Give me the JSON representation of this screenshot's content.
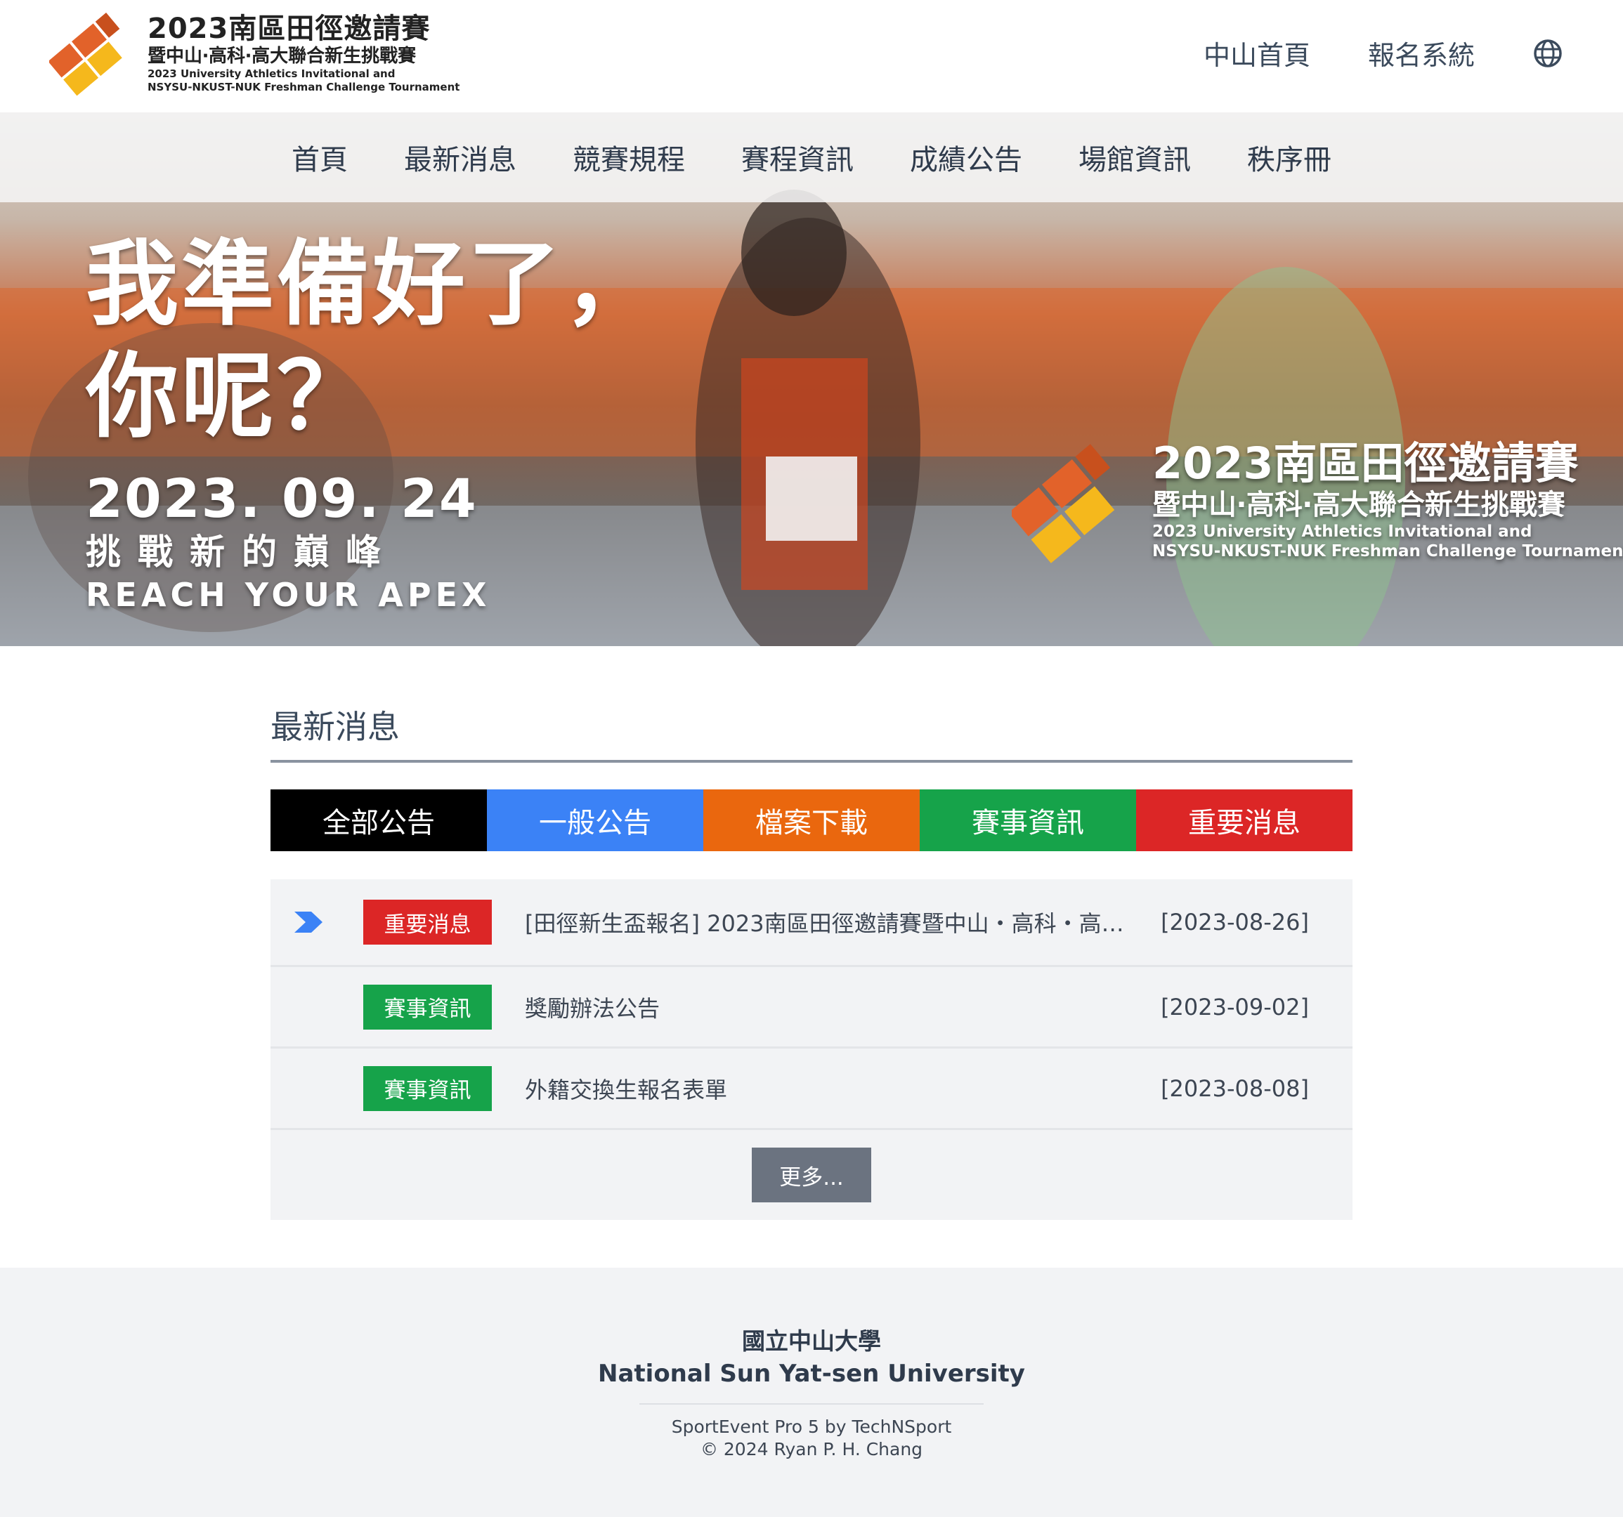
{
  "header": {
    "logo_title": "2023南區田徑邀請賽",
    "logo_subtitle": "暨中山‧高科‧高大聯合新生挑戰賽",
    "logo_en_line1": "2023 University Athletics Invitational and",
    "logo_en_line2": "NSYSU-NKUST-NUK Freshman Challenge Tournament",
    "links": [
      "中山首頁",
      "報名系統"
    ],
    "language_icon": "globe-icon"
  },
  "nav": {
    "items": [
      "首頁",
      "最新消息",
      "競賽規程",
      "賽程資訊",
      "成績公告",
      "場館資訊",
      "秩序冊"
    ]
  },
  "hero": {
    "headline_line1": "我準備好了，",
    "headline_line2": "你呢？",
    "date": "2023. 09. 24",
    "slogan_zh": "挑戰新的巔峰",
    "slogan_en": "REACH YOUR APEX",
    "right_title": "2023南區田徑邀請賽",
    "right_subtitle": "暨中山‧高科‧高大聯合新生挑戰賽",
    "right_en_line1": "2023 University Athletics Invitational and",
    "right_en_line2": "NSYSU-NKUST-NUK Freshman Challenge Tournament"
  },
  "news": {
    "title": "最新消息",
    "tabs": [
      {
        "label": "全部公告",
        "color": "#000000"
      },
      {
        "label": "一般公告",
        "color": "#3b82f6"
      },
      {
        "label": "檔案下載",
        "color": "#ea670e"
      },
      {
        "label": "賽事資訊",
        "color": "#16a34a"
      },
      {
        "label": "重要消息",
        "color": "#dc2626"
      }
    ],
    "items": [
      {
        "badge": "重要消息",
        "badge_color": "#dc2626",
        "text": "[田徑新生盃報名] 2023南區田徑邀請賽暨中山・高科・高…",
        "date": "[2023-08-26]",
        "pinned": true
      },
      {
        "badge": "賽事資訊",
        "badge_color": "#16a34a",
        "text": "獎勵辦法公告",
        "date": "[2023-09-02]",
        "pinned": false
      },
      {
        "badge": "賽事資訊",
        "badge_color": "#16a34a",
        "text": "外籍交換生報名表單",
        "date": "[2023-08-08]",
        "pinned": false
      }
    ],
    "more_label": "更多..."
  },
  "footer": {
    "university_zh": "國立中山大學",
    "university_en": "National Sun Yat-sen University",
    "powered_by": "SportEvent Pro 5 by TechNSport",
    "copyright": "© 2024 Ryan P. H. Chang"
  },
  "colors": {
    "brand_orange": "#e2622a",
    "brand_yellow": "#f5b81c",
    "pin_arrow": "#3b82f6",
    "nav_text": "#2f3b4c"
  }
}
